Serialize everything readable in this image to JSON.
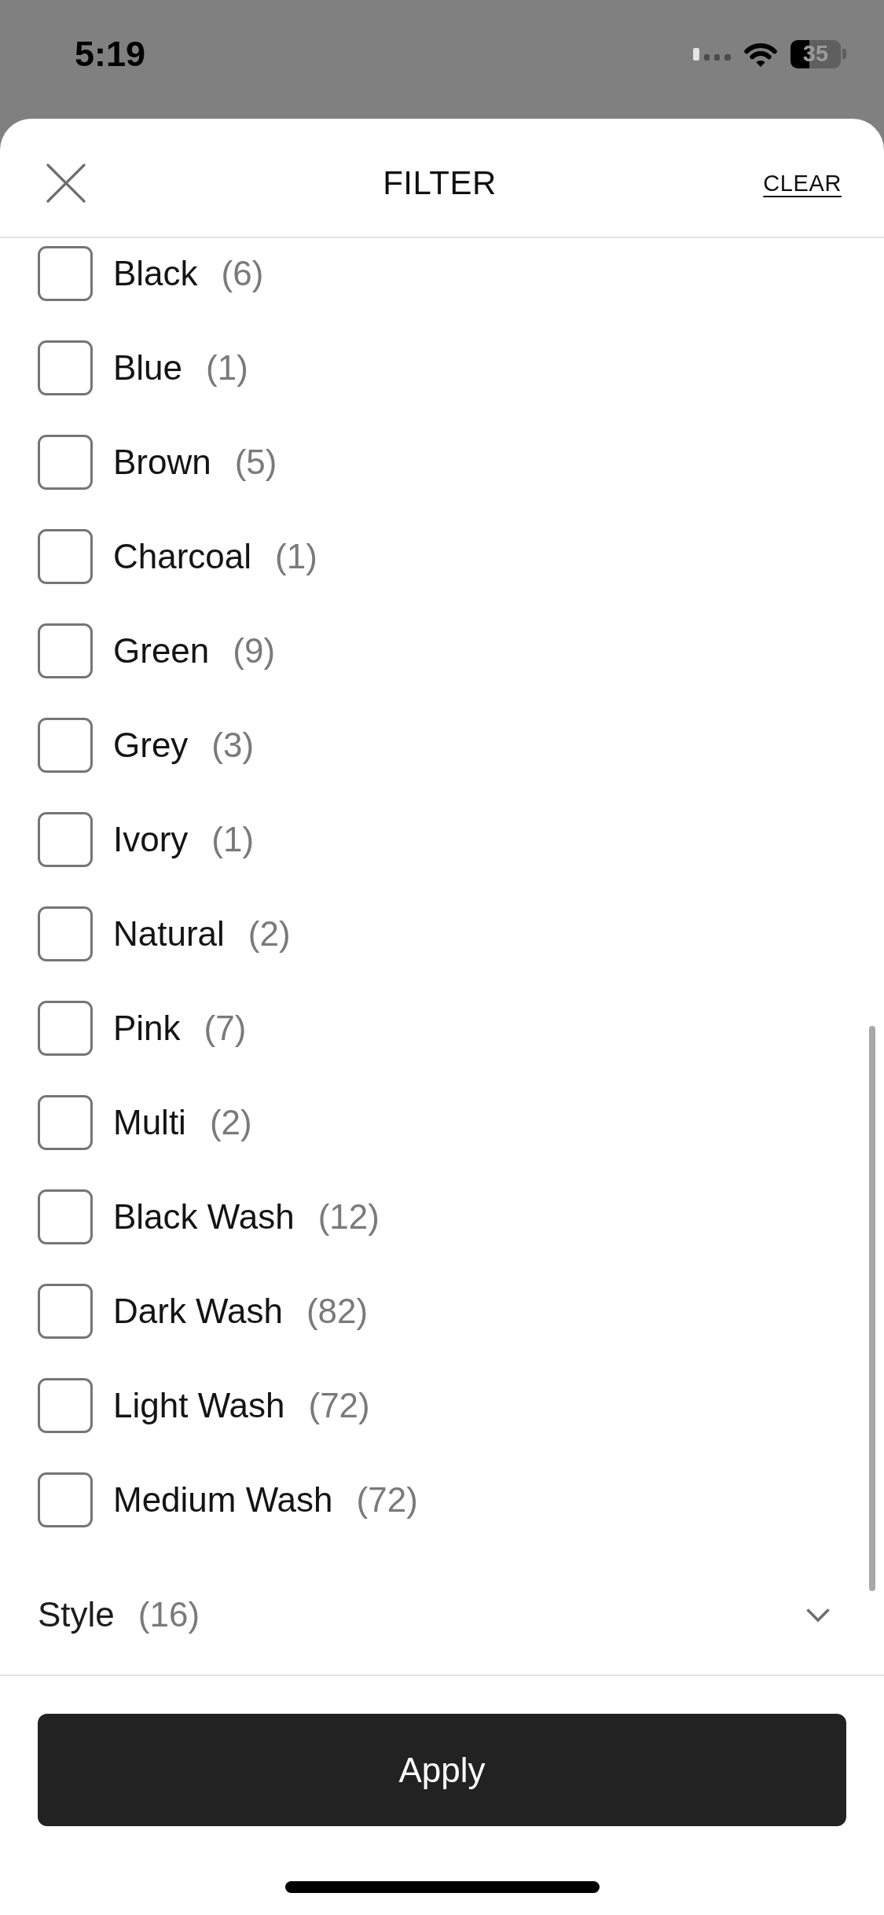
{
  "status_bar": {
    "time": "5:19",
    "battery": "35"
  },
  "header": {
    "title": "FILTER",
    "clear_link": "CLEAR"
  },
  "filter_options": [
    {
      "label": "Black",
      "count": "(6)",
      "checked": false
    },
    {
      "label": "Blue",
      "count": "(1)",
      "checked": false
    },
    {
      "label": "Brown",
      "count": "(5)",
      "checked": false
    },
    {
      "label": "Charcoal",
      "count": "(1)",
      "checked": false
    },
    {
      "label": "Green",
      "count": "(9)",
      "checked": false
    },
    {
      "label": "Grey",
      "count": "(3)",
      "checked": false
    },
    {
      "label": "Ivory",
      "count": "(1)",
      "checked": false
    },
    {
      "label": "Natural",
      "count": "(2)",
      "checked": false
    },
    {
      "label": "Pink",
      "count": "(7)",
      "checked": false
    },
    {
      "label": "Multi",
      "count": "(2)",
      "checked": false
    },
    {
      "label": "Black Wash",
      "count": "(12)",
      "checked": false
    },
    {
      "label": "Dark Wash",
      "count": "(82)",
      "checked": false
    },
    {
      "label": "Light Wash",
      "count": "(72)",
      "checked": false
    },
    {
      "label": "Medium Wash",
      "count": "(72)",
      "checked": false
    }
  ],
  "sections": [
    {
      "title": "Style",
      "count": "(16)",
      "expanded": false
    }
  ],
  "apply_button": {
    "label": "Apply"
  }
}
